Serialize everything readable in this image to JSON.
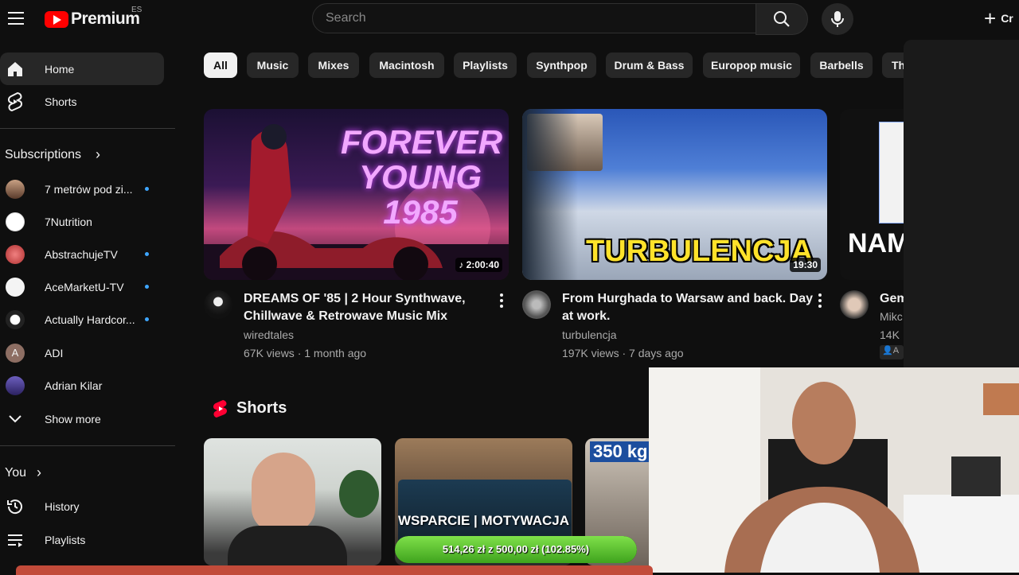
{
  "header": {
    "logo_text": "Premium",
    "region": "ES",
    "search_placeholder": "Search",
    "create_label": "Cr"
  },
  "sidebar": {
    "main": [
      {
        "label": "Home",
        "icon": "home-icon",
        "active": true
      },
      {
        "label": "Shorts",
        "icon": "shorts-icon"
      }
    ],
    "subscriptions_title": "Subscriptions",
    "subscriptions": [
      {
        "label": "7 metrów pod zi...",
        "new": true
      },
      {
        "label": "7Nutrition",
        "new": false
      },
      {
        "label": "AbstrachujeTV",
        "new": true
      },
      {
        "label": "AceMarketU-TV",
        "new": true
      },
      {
        "label": "Actually Hardcor...",
        "new": true
      },
      {
        "label": "ADI",
        "new": false,
        "initial": "A"
      },
      {
        "label": "Adrian Kilar",
        "new": false
      }
    ],
    "show_more": "Show more",
    "you_title": "You",
    "you_items": [
      {
        "label": "History",
        "icon": "history-icon"
      },
      {
        "label": "Playlists",
        "icon": "playlists-icon"
      }
    ]
  },
  "chips": [
    "All",
    "Music",
    "Mixes",
    "Macintosh",
    "Playlists",
    "Synthpop",
    "Drum & Bass",
    "Europop music",
    "Barbells",
    "Th"
  ],
  "videos": [
    {
      "title_line1": "DREAMS OF '85 | 2 Hour Synthwave,",
      "title_line2": "Chillwave & Retrowave Music Mix",
      "channel": "wiredtales",
      "meta": "67K views · 1 month ago",
      "duration": "2:00:40",
      "thumb_text1": "FOREVER",
      "thumb_text2": "YOUNG",
      "thumb_text3": "1985"
    },
    {
      "title_line1": "From Hurghada to Warsaw and back. Day",
      "title_line2": "at work.",
      "channel": "turbulencja",
      "meta": "197K views · 7 days ago",
      "duration": "19:30",
      "thumb_text": "TURBULENCJA"
    },
    {
      "title_line1": "Gem",
      "channel": "Mikc",
      "meta": "14K",
      "thumb_text": "NAM",
      "badge": "A"
    }
  ],
  "shorts": {
    "title": "Shorts",
    "items": [
      {
        "thumb_text": ""
      },
      {
        "thumb_text": "WSPARCIE | MOTYWACJA",
        "donation": "514,26 zł z 500,00 zł (102.85%)",
        "donation_fraction": 1.0285
      },
      {
        "thumb_text": "350 kg"
      }
    ]
  },
  "colors": {
    "background": "#0f0f0f",
    "brand_red": "#ff0000",
    "new_dot": "#3ea6ff"
  }
}
